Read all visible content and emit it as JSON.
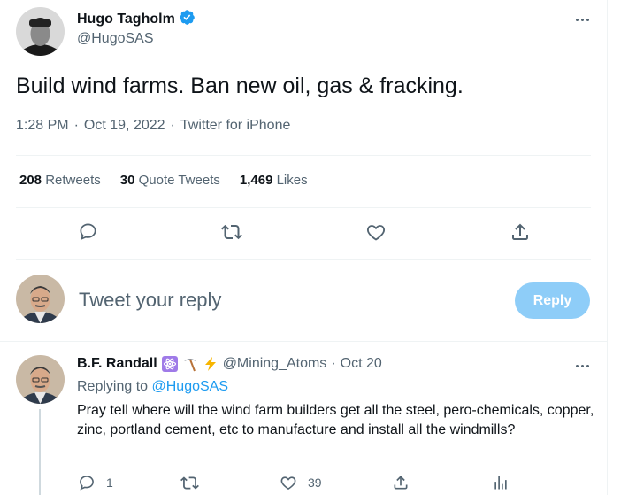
{
  "tweet": {
    "author_name": "Hugo Tagholm",
    "author_handle": "@HugoSAS",
    "verified_icon": "verified-badge-icon",
    "text": "Build wind farms. Ban new oil, gas & fracking.",
    "time": "1:28 PM",
    "date": "Oct 19, 2022",
    "source": "Twitter for iPhone",
    "separator": "·"
  },
  "stats": {
    "retweets_count": "208",
    "retweets_label": "Retweets",
    "quotes_count": "30",
    "quotes_label": "Quote Tweets",
    "likes_count": "1,469",
    "likes_label": "Likes"
  },
  "composer": {
    "placeholder": "Tweet your reply",
    "button_label": "Reply"
  },
  "reply": {
    "author_name": "B.F. Randall",
    "emojis": [
      "atom-emoji-icon",
      "pick-emoji-icon",
      "lightning-emoji-icon"
    ],
    "author_handle": "@Mining_Atoms",
    "separator": "·",
    "date": "Oct 20",
    "replying_prefix": "Replying to",
    "replying_to": "@HugoSAS",
    "text": "Pray tell where will the wind farm builders get all the steel, pero-chemicals, copper, zinc, portland cement, etc to manufacture and install all the windmills?",
    "reply_count": "1",
    "retweet_count": "",
    "like_count": "39"
  },
  "colors": {
    "accent": "#1d9bf0",
    "reply_button_disabled": "#8ecdf8",
    "secondary_text": "#536471",
    "divider": "#eff3f4"
  }
}
